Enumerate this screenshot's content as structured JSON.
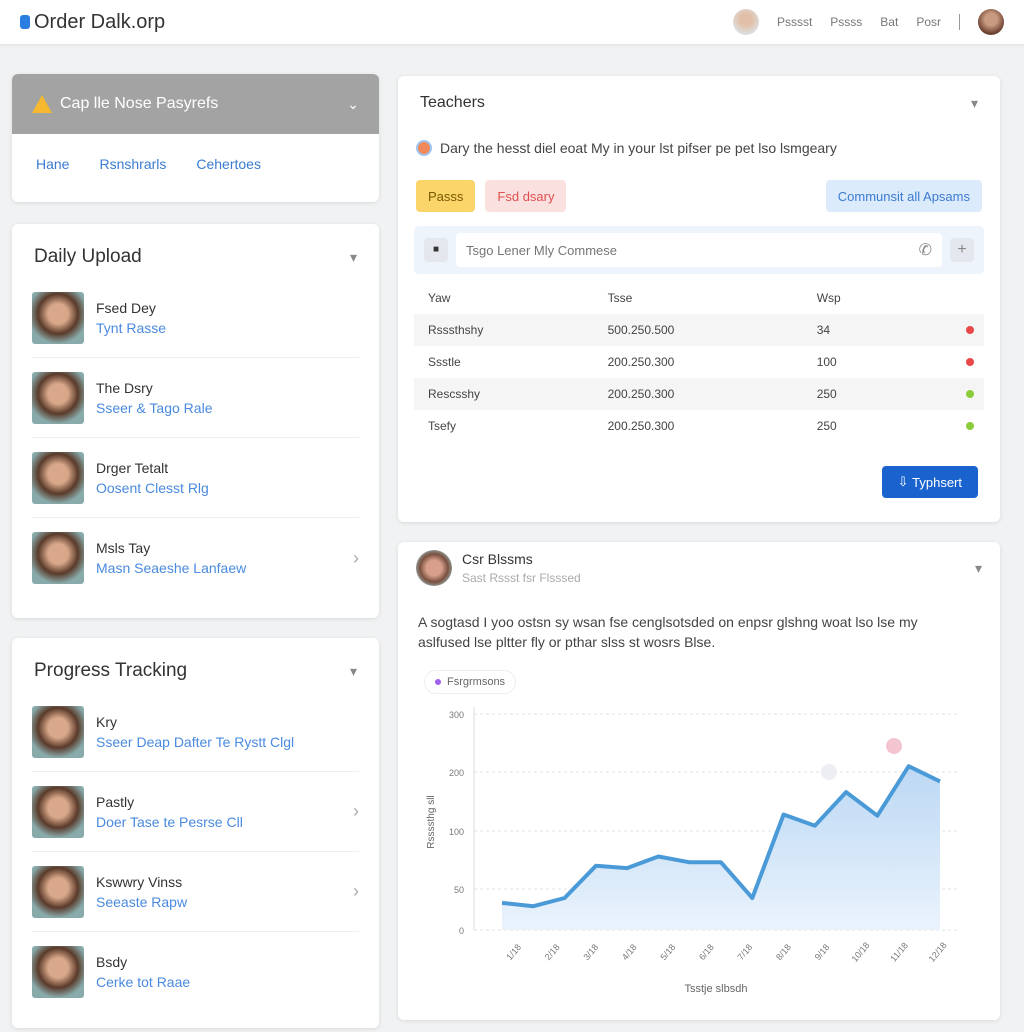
{
  "header": {
    "logo": "Order Dalk.orp",
    "nav": [
      "Psssst",
      "Pssss",
      "Bat",
      "Posr"
    ]
  },
  "alert": {
    "text": "Cap lle Nose Pasyrefs",
    "links": [
      "Hane",
      "Rsnshrarls",
      "Cehertoes"
    ]
  },
  "daily_upload": {
    "title": "Daily Upload",
    "items": [
      {
        "name": "Fsed Dey",
        "sub": "Tynt Rasse"
      },
      {
        "name": "The Dsry",
        "sub": "Sseer & Tago Rale"
      },
      {
        "name": "Drger Tetalt",
        "sub": "Oosent Clesst Rlg"
      },
      {
        "name": "Msls Tay",
        "sub": "Masn Seaeshe Lanfaew"
      }
    ]
  },
  "progress": {
    "title": "Progress Tracking",
    "items": [
      {
        "name": "Kry",
        "sub": "Sseer Deap Dafter Te Rystt Clgl"
      },
      {
        "name": "Pastly",
        "sub": "Doer Tase te Pesrse Cll"
      },
      {
        "name": "Kswwry Vinss",
        "sub": "Seeaste Rapw"
      },
      {
        "name": "Bsdy",
        "sub": "Cerke tot Raae"
      }
    ]
  },
  "teachers": {
    "title": "Teachers",
    "notice": "Dary the hesst diel eoat My in your lst pifser pe pet lso lsmgeary",
    "btn_yellow": "Passs",
    "btn_red": "Fsd dsary",
    "btn_blue": "Communsit all Apsams",
    "input_placeholder": "Tsgo Lener Mly Commese",
    "columns": [
      "Yaw",
      "Tsse",
      "Wsp"
    ],
    "rows": [
      {
        "c": [
          "Rsssthshy",
          "500.250.500",
          "34"
        ],
        "status": "red"
      },
      {
        "c": [
          "Ssstle",
          "200.250.300",
          "100"
        ],
        "status": "red"
      },
      {
        "c": [
          "Rescsshy",
          "200.250.300",
          "250"
        ],
        "status": "green"
      },
      {
        "c": [
          "Tsefy",
          "200.250.300",
          "250"
        ],
        "status": "green"
      }
    ],
    "action": "Typhsert"
  },
  "post": {
    "author": "Csr Blssms",
    "meta": "Sast Rssst fsr Flsssed",
    "text": "A sogtasd I yoo ostsn sy wsan fse cenglsotsded on enpsr glshng woat lso lse my aslfused lse pltter fly or pthar slss st wosrs Blse.",
    "legend": "Fsrgrmsons"
  },
  "colors": {
    "accent": "#2a6fd1",
    "line": "#4a9ad8",
    "red": "#e84848",
    "green": "#8ccc3c"
  },
  "chart_data": {
    "type": "area",
    "ylabel": "Rssssthg sll",
    "xlabel": "Tsstje slbsdh",
    "yticks": [
      0,
      50,
      100,
      200,
      300
    ],
    "xticks": [
      "1/18",
      "2/18",
      "3/18",
      "4/18",
      "5/18",
      "6/18",
      "7/18",
      "8/18",
      "9/18",
      "10/18",
      "11/18",
      "12/18"
    ],
    "grid": true,
    "legend": "top-left",
    "values": [
      33,
      29,
      39,
      70,
      68,
      78,
      73,
      73,
      39,
      128,
      109,
      166,
      126,
      210,
      184
    ]
  }
}
